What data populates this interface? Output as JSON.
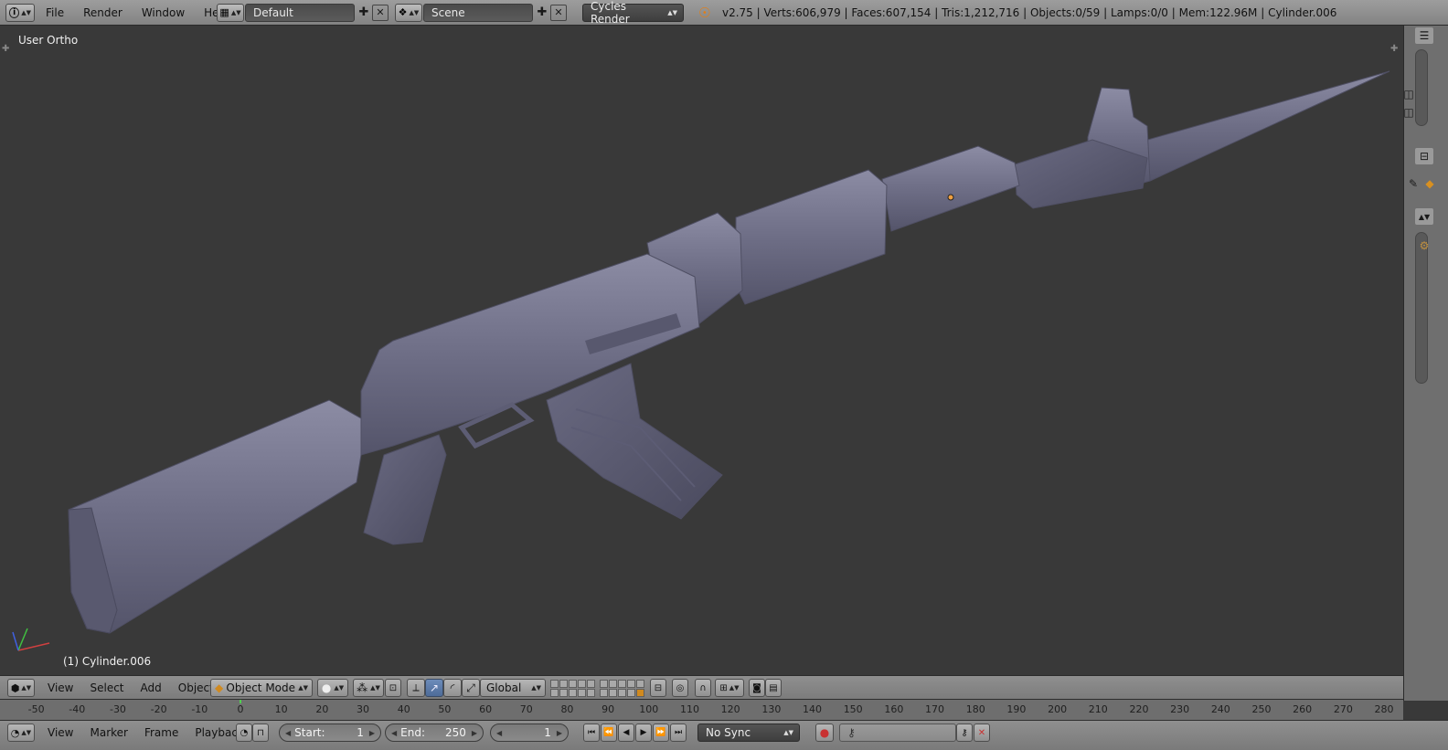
{
  "top_header": {
    "info_icon": "info-icon",
    "menus": [
      "File",
      "Render",
      "Window",
      "Help"
    ],
    "screen_layout": "Default",
    "scene": "Scene",
    "render_engine": "Cycles Render",
    "stats": "v2.75 | Verts:606,979 | Faces:607,154 | Tris:1,212,716 | Objects:0/59 | Lamps:0/0 | Mem:122.96M | Cylinder.006"
  },
  "viewport": {
    "view_title": "User Ortho",
    "object_label": "(1) Cylinder.006"
  },
  "view_header": {
    "menus": [
      "View",
      "Select",
      "Add",
      "Object"
    ],
    "mode": "Object Mode",
    "orientation": "Global"
  },
  "timeline": {
    "ticks": [
      "-50",
      "-40",
      "-30",
      "-20",
      "-10",
      "0",
      "10",
      "20",
      "30",
      "40",
      "50",
      "60",
      "70",
      "80",
      "90",
      "100",
      "110",
      "120",
      "130",
      "140",
      "150",
      "160",
      "170",
      "180",
      "190",
      "200",
      "210",
      "220",
      "230",
      "240",
      "250",
      "260",
      "270",
      "280"
    ],
    "current_frame_on_ruler": 0
  },
  "timeline_header": {
    "menus": [
      "View",
      "Marker",
      "Frame",
      "Playback"
    ],
    "start_label": "Start:",
    "start_value": "1",
    "end_label": "End:",
    "end_value": "250",
    "current_frame": "1",
    "sync_mode": "No Sync"
  },
  "colors": {
    "viewport_bg": "#393939",
    "model": "#6e6e84",
    "accent_blue": "#5680c2",
    "record_red": "#c83232"
  }
}
